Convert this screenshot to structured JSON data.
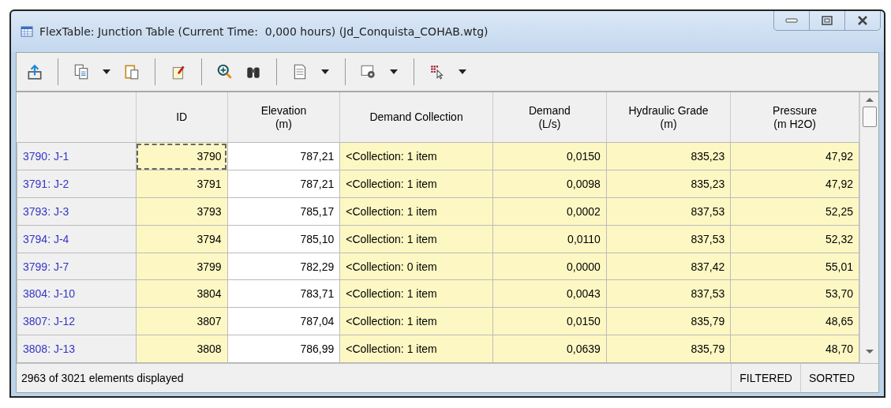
{
  "window": {
    "title": "FlexTable: Junction Table (Current Time:  0,000 hours) (Jd_Conquista_COHAB.wtg)"
  },
  "toolbar": [
    {
      "items": [
        {
          "kind": "export"
        }
      ]
    },
    {
      "items": [
        {
          "kind": "copy"
        },
        {
          "kind": "menu"
        },
        {
          "kind": "paste"
        }
      ]
    },
    {
      "items": [
        {
          "kind": "edit"
        }
      ]
    },
    {
      "items": [
        {
          "kind": "zoom"
        },
        {
          "kind": "find"
        }
      ]
    },
    {
      "items": [
        {
          "kind": "report"
        },
        {
          "kind": "menu"
        }
      ]
    },
    {
      "items": [
        {
          "kind": "options"
        },
        {
          "kind": "menu"
        }
      ]
    },
    {
      "items": [
        {
          "kind": "columns"
        },
        {
          "kind": "menu"
        }
      ]
    }
  ],
  "table": {
    "columns": [
      {
        "label": "ID",
        "editable": false
      },
      {
        "label": "Elevation\n(m)",
        "editable": true
      },
      {
        "label": "Demand Collection",
        "editable": false
      },
      {
        "label": "Demand\n(L/s)",
        "editable": false
      },
      {
        "label": "Hydraulic Grade\n(m)",
        "editable": false
      },
      {
        "label": "Pressure\n(m H2O)",
        "editable": false
      }
    ],
    "rows": [
      {
        "label": "3790: J-1",
        "focused": true,
        "cells": [
          "3790",
          "787,21",
          "<Collection: 1 item",
          "0,0150",
          "835,23",
          "47,92"
        ]
      },
      {
        "label": "3791: J-2",
        "focused": false,
        "cells": [
          "3791",
          "787,21",
          "<Collection: 1 item",
          "0,0098",
          "835,23",
          "47,92"
        ]
      },
      {
        "label": "3793: J-3",
        "focused": false,
        "cells": [
          "3793",
          "785,17",
          "<Collection: 1 item",
          "0,0002",
          "837,53",
          "52,25"
        ]
      },
      {
        "label": "3794: J-4",
        "focused": false,
        "cells": [
          "3794",
          "785,10",
          "<Collection: 1 item",
          "0,0110",
          "837,53",
          "52,32"
        ]
      },
      {
        "label": "3799: J-7",
        "focused": false,
        "cells": [
          "3799",
          "782,29",
          "<Collection: 0 item",
          "0,0000",
          "837,42",
          "55,01"
        ]
      },
      {
        "label": "3804: J-10",
        "focused": false,
        "cells": [
          "3804",
          "783,71",
          "<Collection: 1 item",
          "0,0043",
          "837,53",
          "53,70"
        ]
      },
      {
        "label": "3807: J-12",
        "focused": false,
        "cells": [
          "3807",
          "787,04",
          "<Collection: 1 item",
          "0,0150",
          "835,79",
          "48,65"
        ]
      },
      {
        "label": "3808: J-13",
        "focused": false,
        "cells": [
          "3808",
          "786,99",
          "<Collection: 1 item",
          "0,0639",
          "835,79",
          "48,70"
        ]
      }
    ]
  },
  "status_bar": {
    "message": "2963 of 3021 elements displayed",
    "indicators": [
      "FILTERED",
      "SORTED"
    ]
  }
}
